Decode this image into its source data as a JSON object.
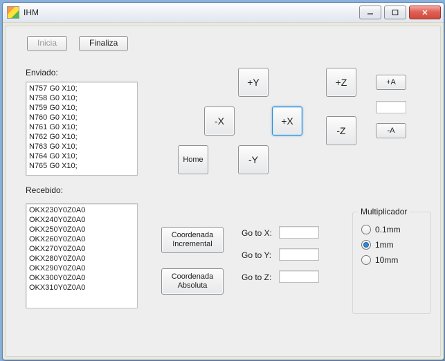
{
  "window": {
    "title": "IHM",
    "buttons": {
      "min": "–",
      "max": "▢",
      "close": "✕"
    }
  },
  "toolbar": {
    "inicia": "Inicia",
    "finaliza": "Finaliza"
  },
  "labels": {
    "enviado": "Enviado:",
    "recebido": "Recebido:",
    "gotoX": "Go to X:",
    "gotoY": "Go to Y:",
    "gotoZ": "Go to Z:",
    "multiplicador": "Multiplicador"
  },
  "jog": {
    "plusY": "+Y",
    "minusY": "-Y",
    "plusX": "+X",
    "minusX": "-X",
    "plusZ": "+Z",
    "minusZ": "-Z",
    "plusA": "+A",
    "minusA": "-A",
    "home": "Home"
  },
  "coord": {
    "incremental": "Coordenada Incremental",
    "absoluta": "Coordenada Absoluta"
  },
  "multiplier": {
    "options": [
      "0.1mm",
      "1mm",
      "10mm"
    ],
    "selected": 1
  },
  "goto": {
    "x": "",
    "y": "",
    "z": ""
  },
  "aux": {
    "aValue": ""
  },
  "enviado_lines": [
    "N757 G0 X10;",
    "N758 G0 X10;",
    "N759 G0 X10;",
    "N760 G0 X10;",
    "N761 G0 X10;",
    "N762 G0 X10;",
    "N763 G0 X10;",
    "N764 G0 X10;",
    "N765 G0 X10;"
  ],
  "recebido_lines": [
    "OKX230Y0Z0A0",
    "OKX240Y0Z0A0",
    "OKX250Y0Z0A0",
    "OKX260Y0Z0A0",
    "OKX270Y0Z0A0",
    "OKX280Y0Z0A0",
    "OKX290Y0Z0A0",
    "OKX300Y0Z0A0",
    "OKX310Y0Z0A0"
  ]
}
